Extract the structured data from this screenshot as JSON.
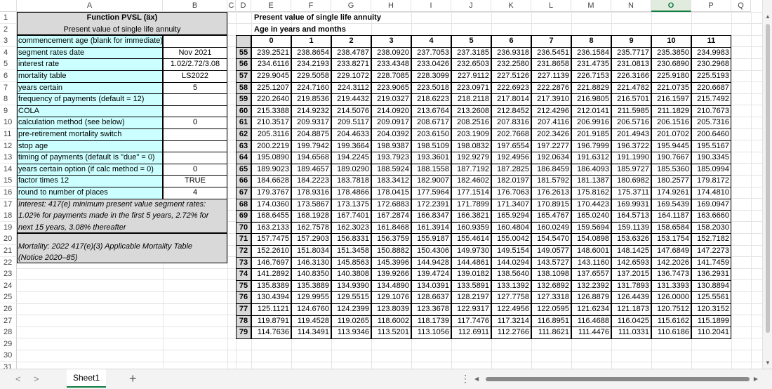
{
  "columns": [
    "A",
    "B",
    "C",
    "D",
    "E",
    "F",
    "G",
    "H",
    "I",
    "J",
    "K",
    "L",
    "M",
    "N",
    "O",
    "P",
    "Q"
  ],
  "rows": [
    "1",
    "2",
    "3",
    "4",
    "5",
    "6",
    "7",
    "8",
    "9",
    "10",
    "11",
    "12",
    "13",
    "14",
    "15",
    "16",
    "17",
    "18",
    "19",
    "20",
    "21",
    "22",
    "23",
    "24",
    "25",
    "26",
    "27",
    "28",
    "29",
    "30",
    "31"
  ],
  "left_panel": {
    "title": "Function PVSL (äx)",
    "subtitle": "Present value of single life annuity",
    "params": [
      {
        "label": "commencement age (blank for immediate)",
        "value": ""
      },
      {
        "label": "segment rates date",
        "value": "Nov 2021"
      },
      {
        "label": "interest rate",
        "value": "1.02/2.72/3.08"
      },
      {
        "label": "mortality table",
        "value": "LS2022"
      },
      {
        "label": "years certain",
        "value": "5"
      },
      {
        "label": "frequency of payments (default = 12)",
        "value": ""
      },
      {
        "label": "COLA",
        "value": ""
      },
      {
        "label": "calculation method (see below)",
        "value": "0"
      },
      {
        "label": "pre-retirement mortality switch",
        "value": ""
      },
      {
        "label": "stop age",
        "value": ""
      },
      {
        "label": "timing of payments (default is \"due\" = 0)",
        "value": ""
      },
      {
        "label": "years certain option (if calc method = 0)",
        "value": "0"
      },
      {
        "label": "factor times 12",
        "value": "TRUE"
      },
      {
        "label": "round to number of places",
        "value": "4"
      }
    ],
    "note_interest": [
      "Interest: 417(e) minimum present value segment rates:",
      "1.02% for payments made in the first 5 years, 2.72% for",
      "next 15 years, 3.08% thereafter"
    ],
    "note_mortality": [
      "Mortality: 2022 417(e)(3) Applicable Mortality Table",
      "(Notice 2020–85)"
    ]
  },
  "table": {
    "title": "Present value of single life annuity",
    "subtitle": "Age in years and months",
    "months": [
      "0",
      "1",
      "2",
      "3",
      "4",
      "5",
      "6",
      "7",
      "8",
      "9",
      "10",
      "11"
    ],
    "rows": [
      {
        "age": "55",
        "vals": [
          "239.2521",
          "238.8654",
          "238.4787",
          "238.0920",
          "237.7053",
          "237.3185",
          "236.9318",
          "236.5451",
          "236.1584",
          "235.7717",
          "235.3850",
          "234.9983"
        ]
      },
      {
        "age": "56",
        "vals": [
          "234.6116",
          "234.2193",
          "233.8271",
          "233.4348",
          "233.0426",
          "232.6503",
          "232.2580",
          "231.8658",
          "231.4735",
          "231.0813",
          "230.6890",
          "230.2968"
        ]
      },
      {
        "age": "57",
        "vals": [
          "229.9045",
          "229.5058",
          "229.1072",
          "228.7085",
          "228.3099",
          "227.9112",
          "227.5126",
          "227.1139",
          "226.7153",
          "226.3166",
          "225.9180",
          "225.5193"
        ]
      },
      {
        "age": "58",
        "vals": [
          "225.1207",
          "224.7160",
          "224.3112",
          "223.9065",
          "223.5018",
          "223.0971",
          "222.6923",
          "222.2876",
          "221.8829",
          "221.4782",
          "221.0735",
          "220.6687"
        ]
      },
      {
        "age": "59",
        "vals": [
          "220.2640",
          "219.8536",
          "219.4432",
          "219.0327",
          "218.6223",
          "218.2118",
          "217.8014",
          "217.3910",
          "216.9805",
          "216.5701",
          "216.1597",
          "215.7492"
        ]
      },
      {
        "age": "60",
        "vals": [
          "215.3388",
          "214.9232",
          "214.5076",
          "214.0920",
          "213.6764",
          "213.2608",
          "212.8452",
          "212.4296",
          "212.0141",
          "211.5985",
          "211.1829",
          "210.7673"
        ]
      },
      {
        "age": "61",
        "vals": [
          "210.3517",
          "209.9317",
          "209.5117",
          "209.0917",
          "208.6717",
          "208.2516",
          "207.8316",
          "207.4116",
          "206.9916",
          "206.5716",
          "206.1516",
          "205.7316"
        ]
      },
      {
        "age": "62",
        "vals": [
          "205.3116",
          "204.8875",
          "204.4633",
          "204.0392",
          "203.6150",
          "203.1909",
          "202.7668",
          "202.3426",
          "201.9185",
          "201.4943",
          "201.0702",
          "200.6460"
        ]
      },
      {
        "age": "63",
        "vals": [
          "200.2219",
          "199.7942",
          "199.3664",
          "198.9387",
          "198.5109",
          "198.0832",
          "197.6554",
          "197.2277",
          "196.7999",
          "196.3722",
          "195.9445",
          "195.5167"
        ]
      },
      {
        "age": "64",
        "vals": [
          "195.0890",
          "194.6568",
          "194.2245",
          "193.7923",
          "193.3601",
          "192.9279",
          "192.4956",
          "192.0634",
          "191.6312",
          "191.1990",
          "190.7667",
          "190.3345"
        ]
      },
      {
        "age": "65",
        "vals": [
          "189.9023",
          "189.4657",
          "189.0290",
          "188.5924",
          "188.1558",
          "187.7192",
          "187.2825",
          "186.8459",
          "186.4093",
          "185.9727",
          "185.5360",
          "185.0994"
        ]
      },
      {
        "age": "66",
        "vals": [
          "184.6628",
          "184.2223",
          "183.7818",
          "183.3412",
          "182.9007",
          "182.4602",
          "182.0197",
          "181.5792",
          "181.1387",
          "180.6982",
          "180.2577",
          "179.8172"
        ]
      },
      {
        "age": "67",
        "vals": [
          "179.3767",
          "178.9316",
          "178.4866",
          "178.0415",
          "177.5964",
          "177.1514",
          "176.7063",
          "176.2613",
          "175.8162",
          "175.3711",
          "174.9261",
          "174.4810"
        ]
      },
      {
        "age": "68",
        "vals": [
          "174.0360",
          "173.5867",
          "173.1375",
          "172.6883",
          "172.2391",
          "171.7899",
          "171.3407",
          "170.8915",
          "170.4423",
          "169.9931",
          "169.5439",
          "169.0947"
        ]
      },
      {
        "age": "69",
        "vals": [
          "168.6455",
          "168.1928",
          "167.7401",
          "167.2874",
          "166.8347",
          "166.3821",
          "165.9294",
          "165.4767",
          "165.0240",
          "164.5713",
          "164.1187",
          "163.6660"
        ]
      },
      {
        "age": "70",
        "vals": [
          "163.2133",
          "162.7578",
          "162.3023",
          "161.8468",
          "161.3914",
          "160.9359",
          "160.4804",
          "160.0249",
          "159.5694",
          "159.1139",
          "158.6584",
          "158.2030"
        ]
      },
      {
        "age": "71",
        "vals": [
          "157.7475",
          "157.2903",
          "156.8331",
          "156.3759",
          "155.9187",
          "155.4614",
          "155.0042",
          "154.5470",
          "154.0898",
          "153.6326",
          "153.1754",
          "152.7182"
        ]
      },
      {
        "age": "72",
        "vals": [
          "152.2610",
          "151.8034",
          "151.3458",
          "150.8882",
          "150.4306",
          "149.9730",
          "149.5154",
          "149.0577",
          "148.6001",
          "148.1425",
          "147.6849",
          "147.2273"
        ]
      },
      {
        "age": "73",
        "vals": [
          "146.7697",
          "146.3130",
          "145.8563",
          "145.3996",
          "144.9428",
          "144.4861",
          "144.0294",
          "143.5727",
          "143.1160",
          "142.6593",
          "142.2026",
          "141.7459"
        ]
      },
      {
        "age": "74",
        "vals": [
          "141.2892",
          "140.8350",
          "140.3808",
          "139.9266",
          "139.4724",
          "139.0182",
          "138.5640",
          "138.1098",
          "137.6557",
          "137.2015",
          "136.7473",
          "136.2931"
        ]
      },
      {
        "age": "75",
        "vals": [
          "135.8389",
          "135.3889",
          "134.9390",
          "134.4890",
          "134.0391",
          "133.5891",
          "133.1392",
          "132.6892",
          "132.2392",
          "131.7893",
          "131.3393",
          "130.8894"
        ]
      },
      {
        "age": "76",
        "vals": [
          "130.4394",
          "129.9955",
          "129.5515",
          "129.1076",
          "128.6637",
          "128.2197",
          "127.7758",
          "127.3318",
          "126.8879",
          "126.4439",
          "126.0000",
          "125.5561"
        ]
      },
      {
        "age": "77",
        "vals": [
          "125.1121",
          "124.6760",
          "124.2399",
          "123.8039",
          "123.3678",
          "122.9317",
          "122.4956",
          "122.0595",
          "121.6234",
          "121.1873",
          "120.7512",
          "120.3152"
        ]
      },
      {
        "age": "78",
        "vals": [
          "119.8791",
          "119.4528",
          "119.0265",
          "118.6002",
          "118.1739",
          "117.7476",
          "117.3214",
          "116.8951",
          "116.4688",
          "116.0425",
          "115.6162",
          "115.1899"
        ]
      },
      {
        "age": "79",
        "vals": [
          "114.7636",
          "114.3491",
          "113.9346",
          "113.5201",
          "113.1056",
          "112.6911",
          "112.2766",
          "111.8621",
          "111.4476",
          "111.0331",
          "110.6186",
          "110.2041"
        ]
      }
    ]
  },
  "tabs": {
    "sheet": "Sheet1",
    "add": "+",
    "nav_prev": "<",
    "nav_next": ">",
    "more": "⋮"
  },
  "colors": {
    "param_fill": "#ccffff",
    "note_fill": "#d9d9d9",
    "accent": "#107c41"
  }
}
